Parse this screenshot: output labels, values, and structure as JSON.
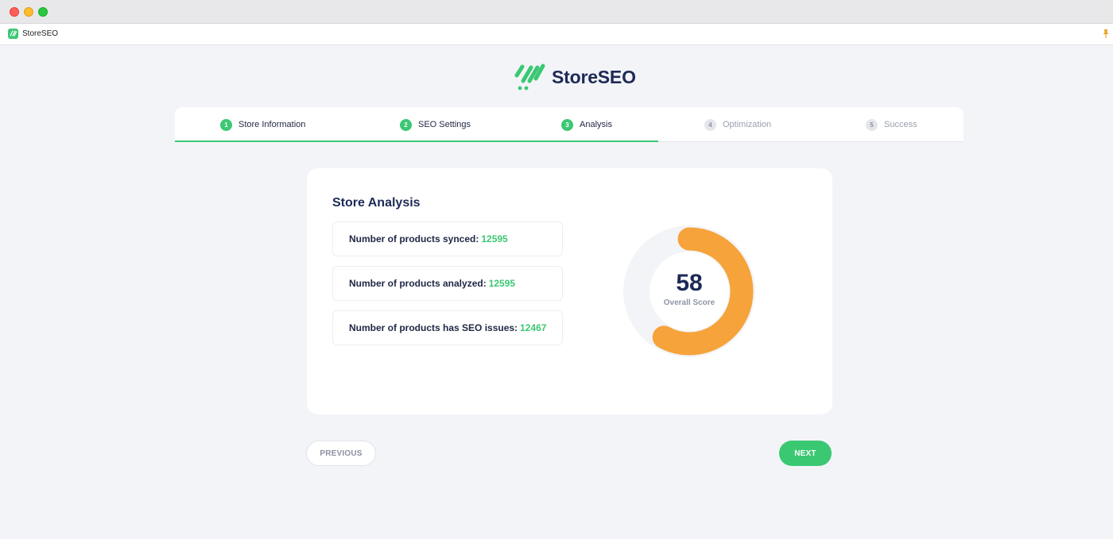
{
  "window": {
    "tab_title": "StoreSEO"
  },
  "brand": {
    "name": "StoreSEO",
    "icon": "storeseo-logo-icon"
  },
  "stepper": {
    "steps": [
      {
        "number": "1",
        "label": "Store Information",
        "state": "done"
      },
      {
        "number": "2",
        "label": "SEO Settings",
        "state": "done"
      },
      {
        "number": "3",
        "label": "Analysis",
        "state": "current"
      },
      {
        "number": "4",
        "label": "Optimization",
        "state": "pending"
      },
      {
        "number": "5",
        "label": "Success",
        "state": "pending"
      }
    ]
  },
  "analysis": {
    "title": "Store Analysis",
    "stats": [
      {
        "label": "Number of products synced:",
        "value": "12595"
      },
      {
        "label": "Number of products analyzed:",
        "value": "12595"
      },
      {
        "label": "Number of products has SEO issues:",
        "value": "12467"
      }
    ],
    "score": {
      "value": "58",
      "label": "Overall Score",
      "fraction": 0.58
    }
  },
  "buttons": {
    "previous": "PREVIOUS",
    "next": "NEXT"
  },
  "colors": {
    "accent": "#3bc873",
    "brand_navy": "#1d2a57",
    "score_orange": "#f5a33a",
    "background": "#f3f4f8"
  }
}
